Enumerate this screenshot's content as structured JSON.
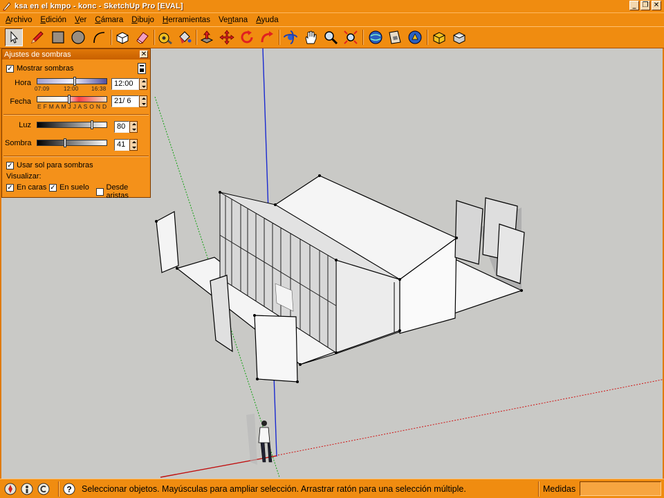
{
  "window": {
    "title": "ksa en el kmpo - konc - SketchUp Pro [EVAL]",
    "buttons": {
      "minimize": "_",
      "restore": "❐",
      "close": "✕"
    }
  },
  "menu": [
    {
      "pre": "",
      "ul": "A",
      "post": "rchivo"
    },
    {
      "pre": "",
      "ul": "E",
      "post": "dición"
    },
    {
      "pre": "",
      "ul": "V",
      "post": "er"
    },
    {
      "pre": "",
      "ul": "C",
      "post": "ámara"
    },
    {
      "pre": "",
      "ul": "D",
      "post": "ibujo"
    },
    {
      "pre": "",
      "ul": "H",
      "post": "erramientas"
    },
    {
      "pre": "Ve",
      "ul": "n",
      "post": "tana"
    },
    {
      "pre": "",
      "ul": "A",
      "post": "yuda"
    }
  ],
  "toolbar": {
    "tools": [
      "select-icon",
      "pencil-icon",
      "rectangle-icon",
      "circle-icon",
      "arc-icon",
      "make-component-icon",
      "eraser-icon",
      "tape-measure-icon",
      "paint-bucket-icon",
      "push-pull-icon",
      "move-icon",
      "rotate-icon",
      "follow-me-icon",
      "orbit-icon",
      "pan-icon",
      "zoom-icon",
      "zoom-extents-icon",
      "get-models-icon",
      "share-model-icon",
      "3d-warehouse-icon",
      "components-icon",
      "materials-icon"
    ]
  },
  "shadow_panel": {
    "title": "Ajustes de sombras",
    "close": "✕",
    "show_shadows": {
      "label": "Mostrar sombras",
      "checked": true
    },
    "hora": {
      "label": "Hora",
      "ticks": [
        "07:09",
        "12:00",
        "16:38"
      ],
      "value": "12:00",
      "level_percent": 55
    },
    "fecha": {
      "label": "Fecha",
      "months": "E F M A M J J A S O N D",
      "value": "21/ 6",
      "level_percent": 47
    },
    "luz": {
      "label": "Luz",
      "value": "80",
      "level_percent": 80
    },
    "sombra": {
      "label": "Sombra",
      "value": "41",
      "level_percent": 41
    },
    "use_sun": {
      "label": "Usar sol para sombras",
      "checked": true
    },
    "visualizar": {
      "label": "Visualizar:",
      "on_faces": {
        "label": "En caras",
        "checked": true
      },
      "on_ground": {
        "label": "En suelo",
        "checked": true
      },
      "from_edges": {
        "label": "Desde aristas",
        "checked": false
      }
    }
  },
  "status": {
    "icons": [
      "geo-location-icon",
      "credits-icon",
      "copyright-icon",
      "help-icon"
    ],
    "text": "Seleccionar objetos. Mayúsculas para ampliar selección. Arrastrar ratón para una selección múltiple.",
    "measures_label": "Medidas",
    "measures_value": ""
  },
  "colors": {
    "chrome_orange": "#f08c10",
    "viewport_bg": "#c9c9c6",
    "axis_blue": "#1a2ad0",
    "axis_red": "#d01010",
    "axis_green": "#10a010"
  }
}
